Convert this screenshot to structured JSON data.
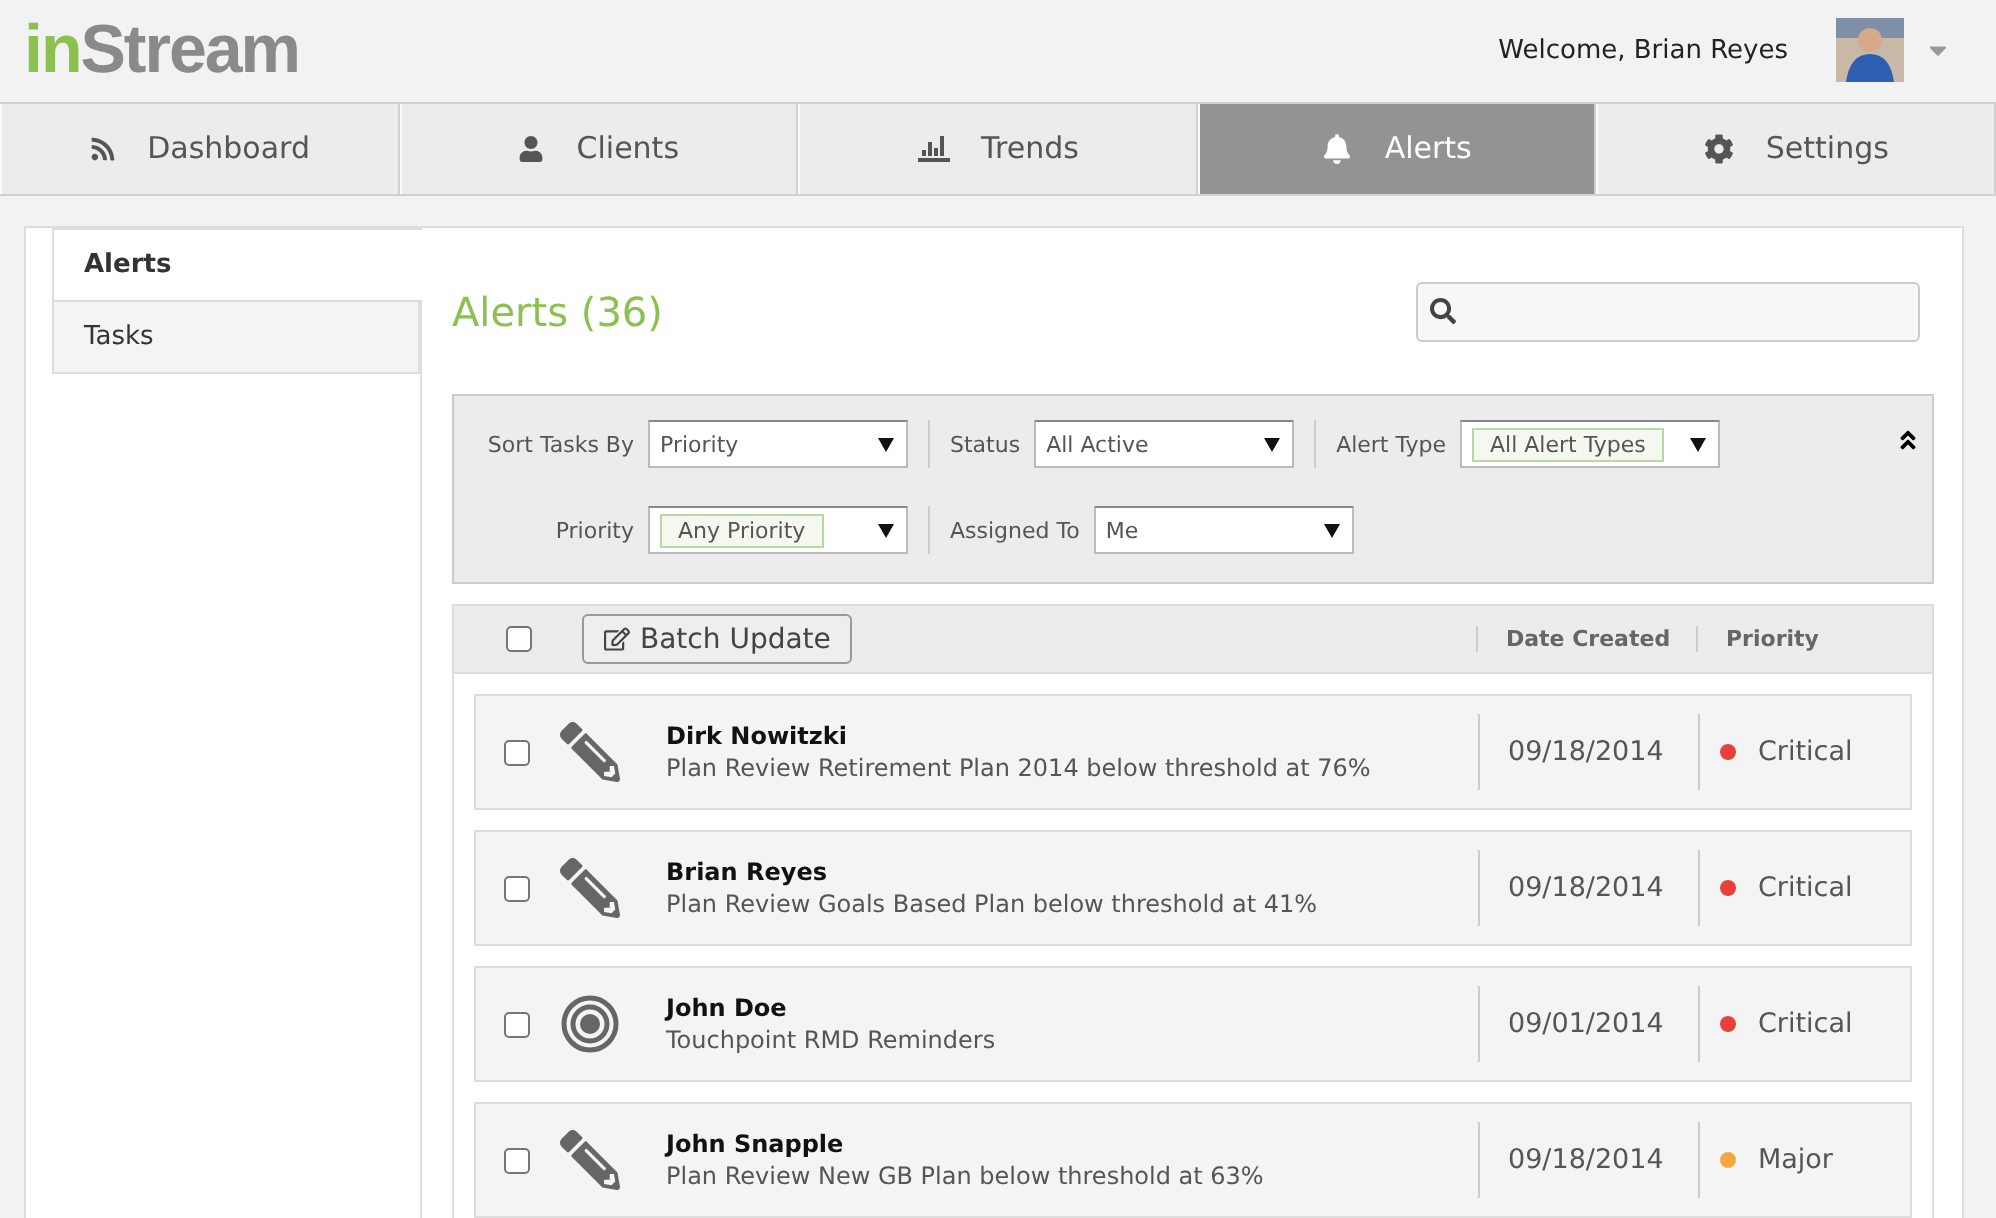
{
  "logo": {
    "accent": "in",
    "rest": "Stream"
  },
  "user": {
    "welcome": "Welcome, Brian Reyes"
  },
  "nav": [
    {
      "label": "Dashboard",
      "selected": false
    },
    {
      "label": "Clients",
      "selected": false
    },
    {
      "label": "Trends",
      "selected": false
    },
    {
      "label": "Alerts",
      "selected": true
    },
    {
      "label": "Settings",
      "selected": false
    }
  ],
  "sidebar": {
    "items": [
      {
        "label": "Alerts",
        "selected": true
      },
      {
        "label": "Tasks",
        "selected": false
      }
    ]
  },
  "heading": "Alerts (36)",
  "filters": [
    [
      {
        "label": "Sort Tasks By",
        "value": "Priority",
        "tagged": false
      },
      {
        "label": "Status",
        "value": "All Active",
        "tagged": false
      },
      {
        "label": "Alert Type",
        "value": "All Alert Types",
        "tagged": true
      }
    ],
    [
      {
        "label": "Priority",
        "value": "Any Priority",
        "tagged": true
      },
      {
        "label": "Assigned To",
        "value": "Me",
        "tagged": false
      }
    ]
  ],
  "table": {
    "select_all_checked": false,
    "batch_button": "Batch Update",
    "columns": [
      "Date Created",
      "Priority"
    ],
    "rows": [
      {
        "kind": "edit",
        "name": "Dirk Nowitzki",
        "detail": "Plan Review Retirement Plan 2014 below threshold at 76%",
        "date": "09/18/2014",
        "priority": "Critical",
        "color": "#e8413a",
        "checked": false
      },
      {
        "kind": "edit",
        "name": "Brian Reyes",
        "detail": "Plan Review Goals Based Plan below threshold at 41%",
        "date": "09/18/2014",
        "priority": "Critical",
        "color": "#e8413a",
        "checked": false
      },
      {
        "kind": "target",
        "name": "John Doe",
        "detail": "Touchpoint RMD Reminders",
        "date": "09/01/2014",
        "priority": "Critical",
        "color": "#e8413a",
        "checked": false
      },
      {
        "kind": "edit",
        "name": "John Snapple",
        "detail": "Plan Review New GB Plan below threshold at 63%",
        "date": "09/18/2014",
        "priority": "Major",
        "color": "#f5a742",
        "checked": false
      }
    ]
  }
}
